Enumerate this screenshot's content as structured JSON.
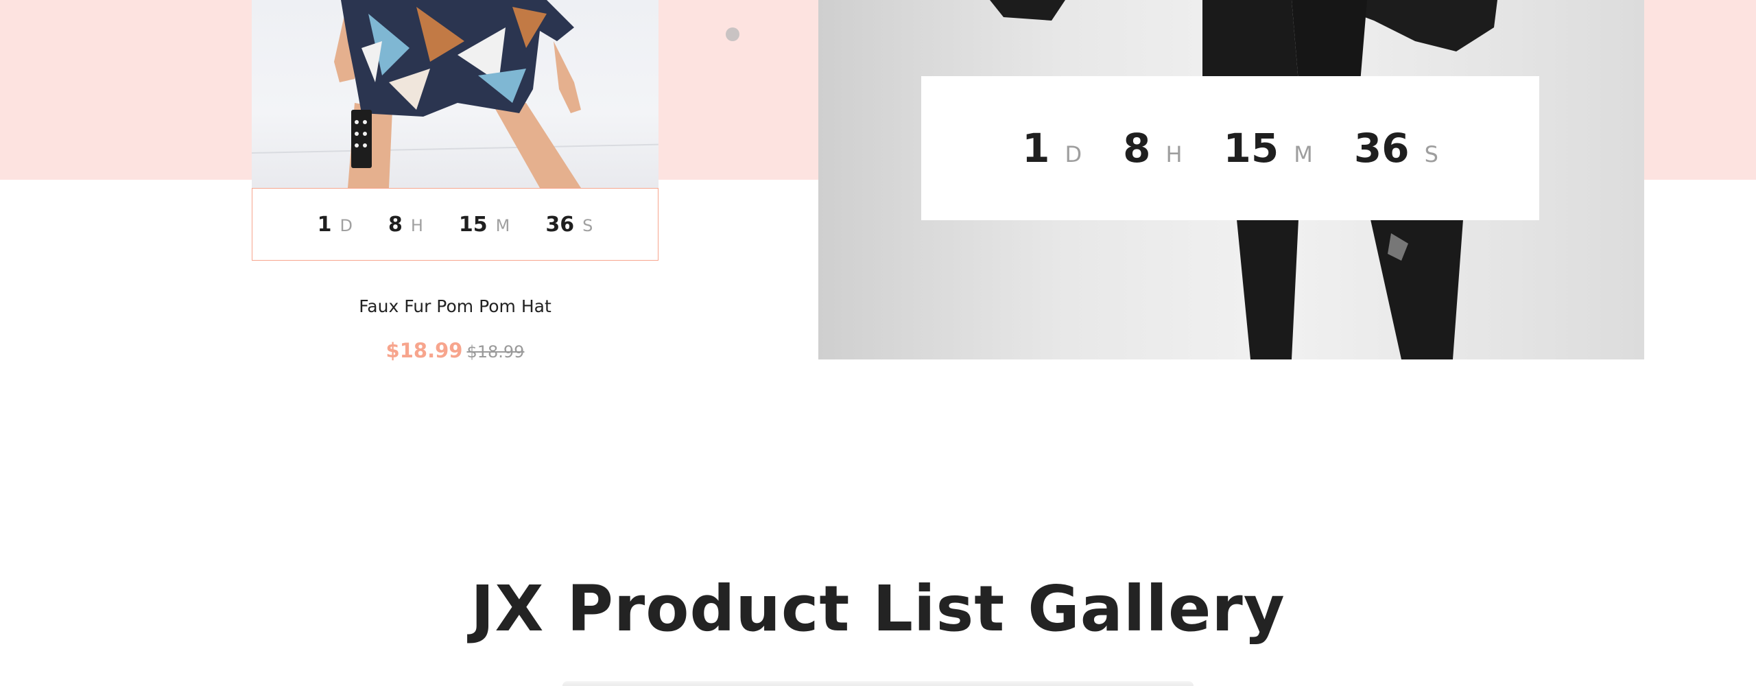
{
  "colors": {
    "accent": "#f7a58d",
    "pink_band": "#fde3e0",
    "text_dark": "#222222",
    "text_muted": "#9a9a9a"
  },
  "product_card": {
    "countdown": [
      {
        "value": "1",
        "unit": "D"
      },
      {
        "value": "8",
        "unit": "H"
      },
      {
        "value": "15",
        "unit": "M"
      },
      {
        "value": "36",
        "unit": "S"
      }
    ],
    "name": "Faux Fur Pom Pom Hat",
    "price_new": "$18.99",
    "price_old": "$18.99"
  },
  "banner": {
    "countdown": [
      {
        "value": "1",
        "unit": "D"
      },
      {
        "value": "8",
        "unit": "H"
      },
      {
        "value": "15",
        "unit": "M"
      },
      {
        "value": "36",
        "unit": "S"
      }
    ]
  },
  "section": {
    "title": "JX Product List Gallery"
  }
}
